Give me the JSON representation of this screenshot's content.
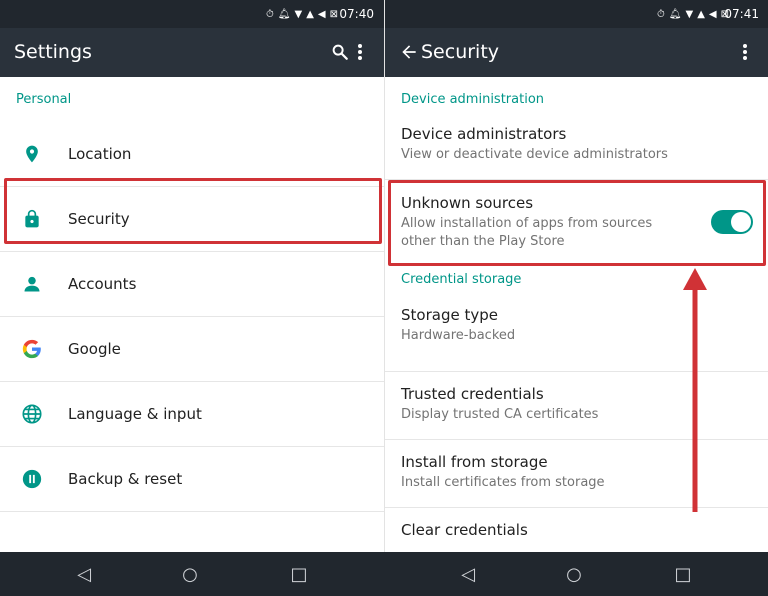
{
  "left": {
    "status_time": "07:40",
    "title": "Settings",
    "section": "Personal",
    "items": [
      {
        "label": "Location",
        "icon": "location-pin-icon"
      },
      {
        "label": "Security",
        "icon": "lock-icon"
      },
      {
        "label": "Accounts",
        "icon": "person-icon"
      },
      {
        "label": "Google",
        "icon": "google-g-icon"
      },
      {
        "label": "Language & input",
        "icon": "globe-icon"
      },
      {
        "label": "Backup & reset",
        "icon": "backup-icon"
      }
    ]
  },
  "right": {
    "status_time": "07:41",
    "title": "Security",
    "section_device": "Device administration",
    "device_admins": {
      "title": "Device administrators",
      "subtitle": "View or deactivate device administrators"
    },
    "unknown_sources": {
      "title": "Unknown sources",
      "subtitle_line1": "Allow installation of apps from sources",
      "subtitle_line2": "other than the Play Store",
      "enabled": true
    },
    "section_credential": "Credential storage",
    "storage_type": {
      "title": "Storage type",
      "subtitle": "Hardware-backed"
    },
    "trusted_credentials": {
      "title": "Trusted credentials",
      "subtitle": "Display trusted CA certificates"
    },
    "install_from_storage": {
      "title": "Install from storage",
      "subtitle": "Install certificates from storage"
    },
    "clear_credentials": {
      "title": "Clear credentials"
    }
  },
  "colors": {
    "accent": "#009688",
    "highlight": "#d03236",
    "app_bar": "#2a323b",
    "status_bar": "#21272e"
  },
  "nav": {
    "back": "◁",
    "home": "○",
    "recents": "□"
  }
}
